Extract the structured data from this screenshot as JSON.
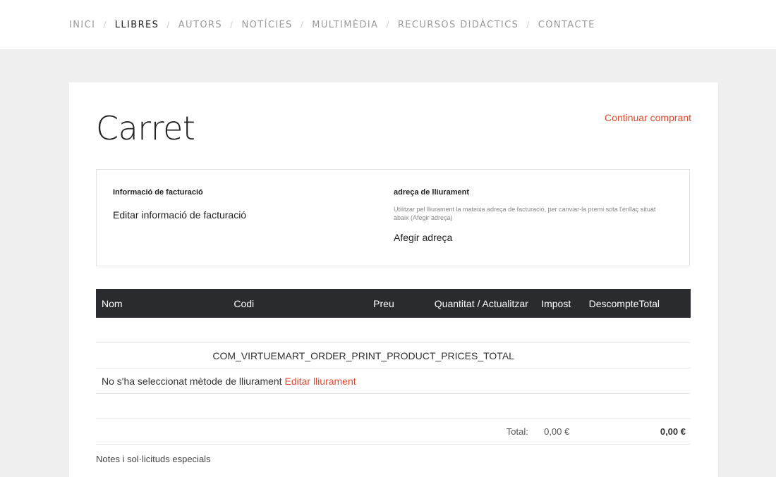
{
  "nav": {
    "items": [
      {
        "label": "INICI",
        "active": false
      },
      {
        "label": "LLIBRES",
        "active": true
      },
      {
        "label": "AUTORS",
        "active": false
      },
      {
        "label": "NOTÍCIES",
        "active": false
      },
      {
        "label": "MULTIMÈDIA",
        "active": false
      },
      {
        "label": "RECURSOS DIDÀCTICS",
        "active": false
      },
      {
        "label": "CONTACTE",
        "active": false
      }
    ],
    "separator": "/"
  },
  "page": {
    "title": "Carret",
    "continue_label": "Continuar comprant"
  },
  "billing": {
    "heading": "Informació de facturació",
    "edit_label": "Editar informació de facturació"
  },
  "shipping": {
    "heading": "adreça de lliurament",
    "help_text": "Utilitzar pel lliurament la mateixa adreça de facturació, per canviar-la premi sota l'enllaç situat abaix (Afegir adreça)",
    "add_label": "Afegir adreça"
  },
  "table": {
    "headers": {
      "nom": "Nom",
      "codi": "Codi",
      "preu": "Preu",
      "quantitat": "Quantitat / Actualitzar",
      "impost": "Impost",
      "descompte": "Descompte",
      "total": "Total"
    },
    "prices_total_placeholder": "COM_VIRTUEMART_ORDER_PRINT_PRODUCT_PRICES_TOTAL",
    "shipment_text": "No s'ha seleccionat mètode de lliurament",
    "shipment_edit_label": "Editar lliurament",
    "total_label": "Total:",
    "total_tax": "0,00 €",
    "total_grand": "0,00 €"
  },
  "notes": {
    "label": "Notes i sol·licituds especials"
  },
  "colors": {
    "accent": "#e04a2f",
    "table_header_bg": "#2a2b2e",
    "page_bg": "#efefef"
  }
}
